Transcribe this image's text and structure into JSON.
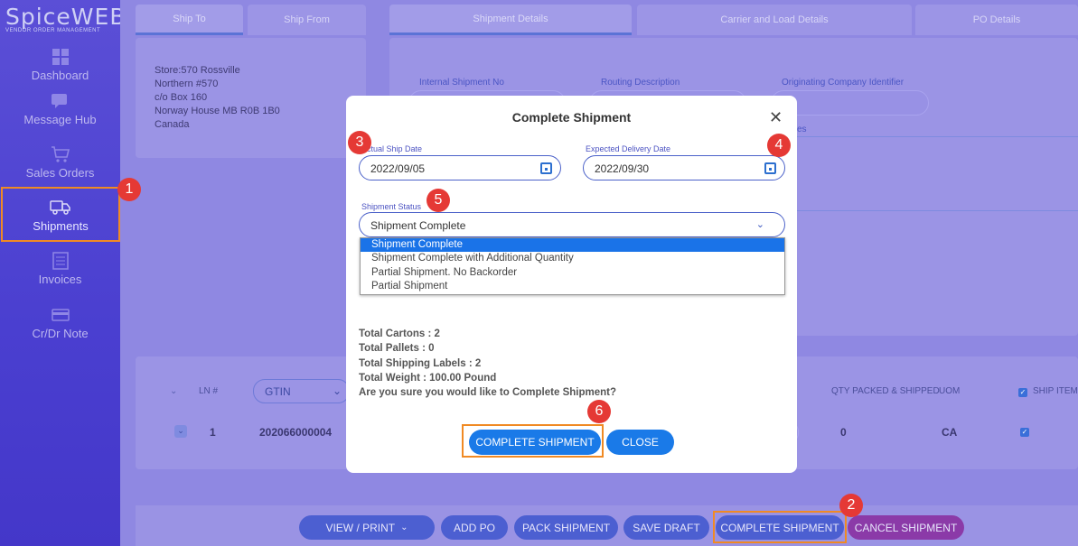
{
  "brand": {
    "name": "SpiceWEB",
    "tagline": "VENDOR ORDER MANAGEMENT"
  },
  "sidebar": {
    "items": [
      {
        "label": "Dashboard",
        "icon": "dashboard-icon"
      },
      {
        "label": "Message Hub",
        "icon": "chat-icon"
      },
      {
        "label": "Sales Orders",
        "icon": "cart-icon"
      },
      {
        "label": "Shipments",
        "icon": "truck-icon",
        "active": true
      },
      {
        "label": "Invoices",
        "icon": "invoice-icon"
      },
      {
        "label": "Cr/Dr Note",
        "icon": "card-icon"
      }
    ]
  },
  "tabs_left": [
    "Ship To",
    "Ship From"
  ],
  "tabs_right": [
    "Shipment Details",
    "Carrier and Load Details",
    "PO Details"
  ],
  "ship_to_address": [
    "Store:570 Rossville",
    "Northern #570",
    "c/o Box 160",
    "Norway House MB R0B 1B0",
    "Canada"
  ],
  "shipment_fields": {
    "internal_no": "Internal Shipment No",
    "routing": "Routing Description",
    "originating": "Originating Company Identifier",
    "partial_label": "es"
  },
  "grid": {
    "headers": {
      "ln": "LN #",
      "qty": "QTY PACKED & SHIPPED",
      "uom": "UOM",
      "ship_item": "SHIP ITEM"
    },
    "gtin_select": "GTIN",
    "row": {
      "ln": "1",
      "gtin": "202066000004",
      "qty": "0",
      "uom": "CA"
    }
  },
  "bottom_buttons": {
    "view_print": "VIEW / PRINT",
    "add_po": "ADD PO",
    "pack": "PACK SHIPMENT",
    "save_draft": "SAVE DRAFT",
    "complete": "COMPLETE SHIPMENT",
    "cancel": "CANCEL SHIPMENT"
  },
  "modal": {
    "title": "Complete Shipment",
    "actual_ship_date_label": "Actual Ship Date",
    "actual_ship_date": "2022/09/05",
    "expected_delivery_label": "Expected Delivery Date",
    "expected_delivery": "2022/09/30",
    "status_label": "Shipment Status",
    "status_value": "Shipment Complete",
    "status_options": [
      "Shipment Complete",
      "Shipment Complete with Additional Quantity",
      "Partial Shipment. No Backorder",
      "Partial Shipment"
    ],
    "summary": {
      "cartons": "Total Cartons : 2",
      "pallets": "Total Pallets : 0",
      "labels": "Total Shipping Labels : 2",
      "weight": "Total Weight : 100.00 Pound",
      "confirm": "Are you sure you would like to Complete Shipment?"
    },
    "complete_button": "COMPLETE SHIPMENT",
    "close_button": "CLOSE"
  },
  "callouts": [
    "1",
    "2",
    "3",
    "4",
    "5",
    "6"
  ],
  "colors": {
    "accent": "#1a7ae8",
    "highlight": "#f08a24",
    "callout": "#e53935",
    "sidebar": "#4a3fd0"
  }
}
